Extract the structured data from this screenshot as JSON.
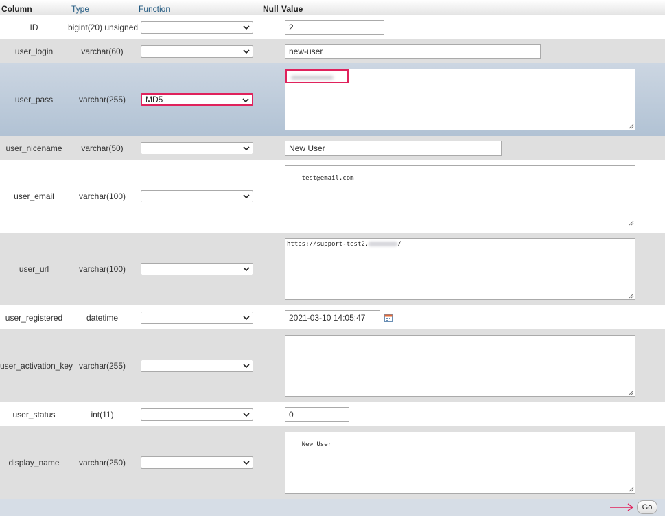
{
  "headers": {
    "column": "Column",
    "type": "Type",
    "function": "Function",
    "null": "Null",
    "value": "Value"
  },
  "rows": [
    {
      "name": "ID",
      "type": "bigint(20) unsigned",
      "function": "",
      "value": "2"
    },
    {
      "name": "user_login",
      "type": "varchar(60)",
      "function": "",
      "value": "new-user"
    },
    {
      "name": "user_pass",
      "type": "varchar(255)",
      "function": "MD5",
      "value": ""
    },
    {
      "name": "user_nicename",
      "type": "varchar(50)",
      "function": "",
      "value": "New User"
    },
    {
      "name": "user_email",
      "type": "varchar(100)",
      "function": "",
      "value": "test@email.com"
    },
    {
      "name": "user_url",
      "type": "varchar(100)",
      "function": "",
      "value": "https://support-test2."
    },
    {
      "name": "user_registered",
      "type": "datetime",
      "function": "",
      "value": "2021-03-10 14:05:47"
    },
    {
      "name": "user_activation_key",
      "type": "varchar(255)",
      "function": "",
      "value": ""
    },
    {
      "name": "user_status",
      "type": "int(11)",
      "function": "",
      "value": "0"
    },
    {
      "name": "display_name",
      "type": "varchar(250)",
      "function": "",
      "value": "New User"
    }
  ],
  "user_url_suffix": "/",
  "go_button": "Go",
  "colors": {
    "highlight": "#e0225c",
    "header_link": "#235a81",
    "row_alt": "#dfdfdf",
    "row_hover": "#b1c2d4"
  },
  "icons": {
    "select_arrow": "chevron-down-icon",
    "calendar": "calendar-icon",
    "pointer": "arrow-right-icon"
  }
}
